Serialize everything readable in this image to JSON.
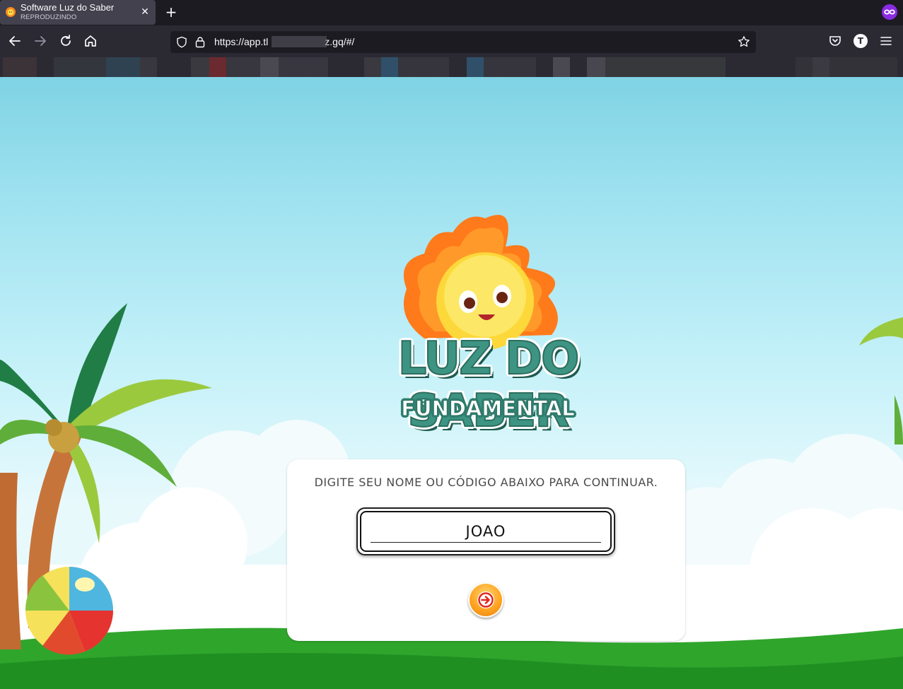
{
  "browser": {
    "tab": {
      "title": "Software Luz do Saber",
      "subtitle": "REPRODUZINDO",
      "close_icon": "close-icon"
    },
    "new_tab_icon": "plus-icon",
    "url": {
      "prefix": "https://app.tl",
      "suffix": "z.gq/#/"
    },
    "nav_icons": [
      "back-arrow-icon",
      "forward-arrow-icon",
      "reload-icon",
      "home-icon"
    ],
    "right_icons": [
      "pocket-icon",
      "account-icon",
      "menu-icon"
    ],
    "account_initial": "T",
    "colors": {
      "tab_bg": "#42414d",
      "toolbar_bg": "#2b2a33",
      "frame_bg": "#1c1b22",
      "private_badge": "#8a2be2"
    }
  },
  "page": {
    "logo": {
      "title": "LUZ DO SABER",
      "subtitle": "FUNDAMENTAL"
    },
    "login": {
      "prompt": "DIGITE SEU NOME OU CÓDIGO ABAIXO PARA CONTINUAR.",
      "name_value": "JOAO",
      "submit_icon": "arrow-right-circle-icon"
    },
    "colors": {
      "logo_green": "#3e9483",
      "button_orange": "#ffa21f",
      "arrow_red": "#e0281e",
      "grass": "#2fa52c",
      "sky": "#9fe2f0"
    }
  }
}
